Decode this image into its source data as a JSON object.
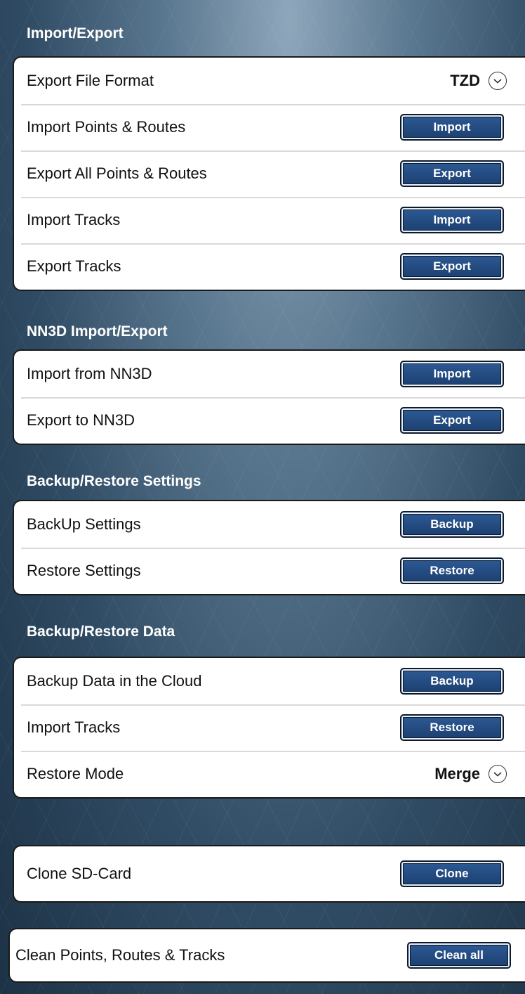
{
  "sections": [
    {
      "title": "Import/Export",
      "rows": [
        {
          "label": "Export File Format",
          "dropdown": "TZD"
        },
        {
          "label": "Import Points & Routes",
          "button": "Import"
        },
        {
          "label": "Export All Points & Routes",
          "button": "Export"
        },
        {
          "label": "Import Tracks",
          "button": "Import"
        },
        {
          "label": "Export Tracks",
          "button": "Export"
        }
      ]
    },
    {
      "title": "NN3D Import/Export",
      "rows": [
        {
          "label": "Import from NN3D",
          "button": "Import"
        },
        {
          "label": "Export to NN3D",
          "button": "Export"
        }
      ]
    },
    {
      "title": "Backup/Restore Settings",
      "rows": [
        {
          "label": "BackUp Settings",
          "button": "Backup"
        },
        {
          "label": "Restore Settings",
          "button": "Restore"
        }
      ]
    },
    {
      "title": "Backup/Restore Data",
      "rows": [
        {
          "label": "Backup Data in the Cloud",
          "button": "Backup"
        },
        {
          "label": "Import Tracks",
          "button": "Restore"
        },
        {
          "label": "Restore Mode",
          "dropdown": "Merge"
        }
      ]
    },
    {
      "title": "",
      "rows": [
        {
          "label": "Clone SD-Card",
          "button": "Clone"
        }
      ]
    },
    {
      "title": "",
      "rows": [
        {
          "label": "Clean Points, Routes & Tracks",
          "button": "Clean all"
        }
      ]
    }
  ],
  "icons": {
    "dropdown": "chevron-down-circle-icon"
  },
  "colors": {
    "button": "#1f4577",
    "button_text": "#ffffff",
    "section_title": "#ffffff"
  }
}
